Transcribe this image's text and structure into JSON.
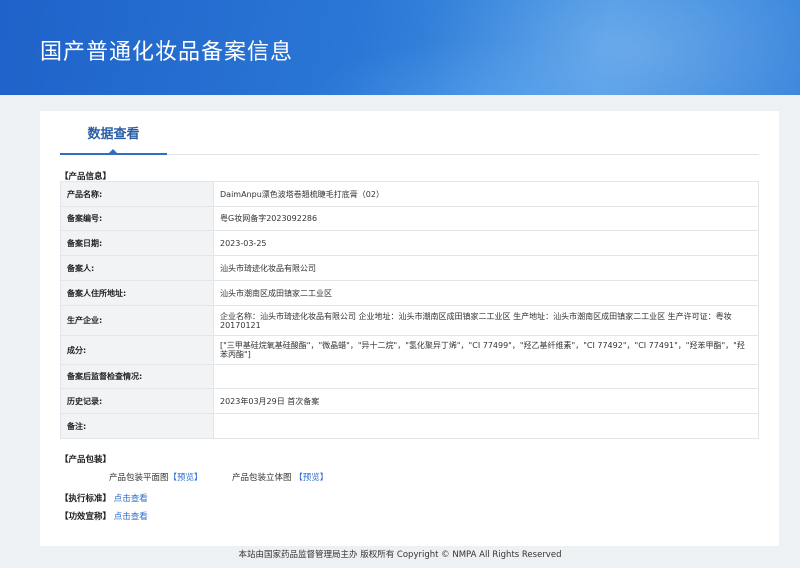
{
  "header": {
    "title": "国产普通化妆品备案信息"
  },
  "tabs": [
    {
      "label": "数据查看"
    }
  ],
  "product_info": {
    "section_label": "【产品信息】",
    "rows": [
      {
        "label": "产品名称:",
        "value": "DaimAnpu漂色波塔卷翘梳睫毛打底膏（02）"
      },
      {
        "label": "备案编号:",
        "value": "粤G妆网备字2023092286"
      },
      {
        "label": "备案日期:",
        "value": "2023-03-25"
      },
      {
        "label": "备案人:",
        "value": "汕头市琦迹化妆品有限公司"
      },
      {
        "label": "备案人住所地址:",
        "value": "汕头市潮南区成田镇家二工业区"
      },
      {
        "label": "生产企业:",
        "value": "企业名称：汕头市琦迹化妆品有限公司 企业地址：汕头市潮南区成田镇家二工业区 生产地址：汕头市潮南区成田镇家二工业区 生产许可证：粤妆20170121"
      },
      {
        "label": "成分:",
        "value": "[\"三甲基硅烷氧基硅酸酯\"，\"微晶蜡\"，\"异十二烷\"，\"氢化聚异丁烯\"，\"CI 77499\"，\"羟乙基纤维素\"，\"CI 77492\"，\"CI 77491\"，\"羟苯甲酯\"，\"羟苯丙酯\"]"
      },
      {
        "label": "备案后监督检查情况:",
        "value": ""
      },
      {
        "label": "历史记录:",
        "value": "2023年03月29日  首次备案"
      },
      {
        "label": "备注:",
        "value": ""
      }
    ]
  },
  "packaging": {
    "section_label": "【产品包装】",
    "flat_label": "产品包装平面图",
    "flat_link": "【预览】",
    "solid_label": "产品包装立体图",
    "solid_link": "【预览】"
  },
  "standard": {
    "label": "【执行标准】",
    "link": "点击查看"
  },
  "claims": {
    "label": "【功效宣称】",
    "link": "点击查看"
  },
  "footer": {
    "text": "本站由国家药品监督管理局主办 版权所有 Copyright © NMPA All Rights Reserved"
  },
  "colors": {
    "banner": "#2a77d6",
    "accent": "#2f6fc2",
    "link": "#2b6ccd",
    "table_border": "#9fc3e7"
  }
}
